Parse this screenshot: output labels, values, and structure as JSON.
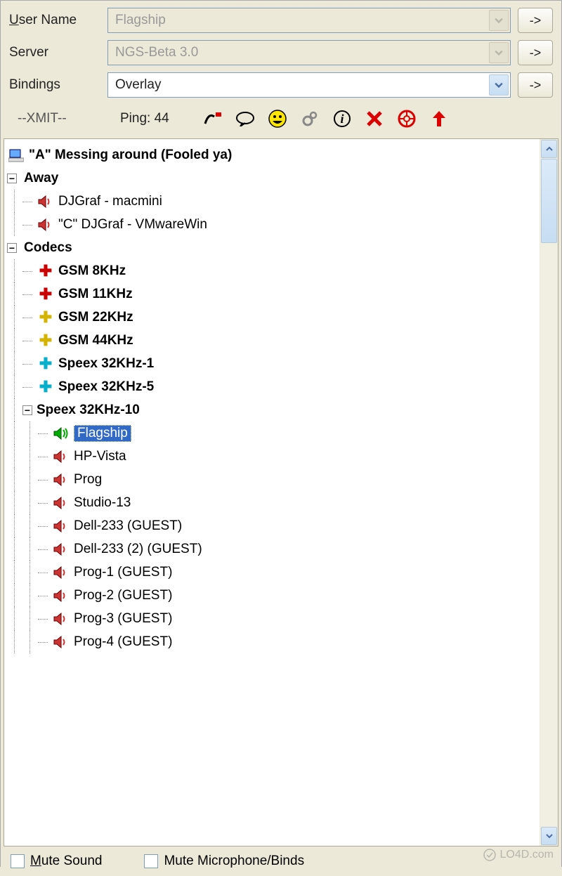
{
  "form": {
    "username_label_pre": "U",
    "username_label_post": "ser Name",
    "username_value": "Flagship",
    "server_label": "Server",
    "server_value": "NGS-Beta 3.0",
    "bindings_label": "Bindings",
    "bindings_value": "Overlay",
    "arrow_btn": "->"
  },
  "status": {
    "xmit": "--XMIT--",
    "ping": "Ping: 44"
  },
  "tree": {
    "root": "\"A\" Messing around (Fooled ya)",
    "away": "Away",
    "away_users": [
      "DJGraf - macmini",
      "\"C\" DJGraf - VMwareWin"
    ],
    "codecs": "Codecs",
    "codec_list": [
      {
        "label": "GSM 8KHz",
        "plus": "red"
      },
      {
        "label": "GSM 11KHz",
        "plus": "red"
      },
      {
        "label": "GSM 22KHz",
        "plus": "yellow"
      },
      {
        "label": "GSM 44KHz",
        "plus": "yellow"
      },
      {
        "label": "Speex 32KHz-1",
        "plus": "cyan"
      },
      {
        "label": "Speex 32KHz-5",
        "plus": "cyan"
      }
    ],
    "active_codec": "Speex 32KHz-10",
    "self_user": "Flagship",
    "users": [
      "HP-Vista",
      "Prog",
      "Studio-13",
      "Dell-233 (GUEST)",
      "Dell-233 (2) (GUEST)",
      "Prog-1 (GUEST)",
      "Prog-2 (GUEST)",
      "Prog-3 (GUEST)",
      "Prog-4 (GUEST)"
    ]
  },
  "footer": {
    "mute_sound_pre": "M",
    "mute_sound_post": "ute Sound",
    "mute_mic": "Mute Microphone/Binds"
  },
  "watermark": "LO4D.com"
}
